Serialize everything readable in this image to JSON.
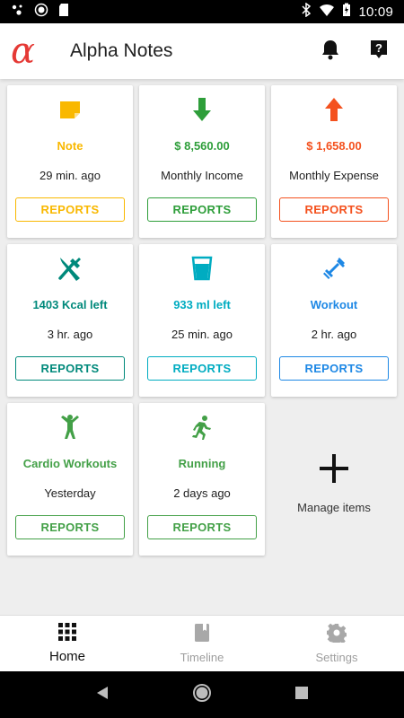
{
  "status_bar": {
    "time": "10:09"
  },
  "app": {
    "title": "Alpha Notes",
    "logo_glyph": "α",
    "logo_color": "#e53935"
  },
  "cards": [
    {
      "key": "note",
      "icon": "note-icon",
      "value": "Note",
      "sub": "29 min. ago",
      "button": "REPORTS",
      "color": "#f9b800"
    },
    {
      "key": "income",
      "icon": "arrow-down-icon",
      "value": "$ 8,560.00",
      "sub": "Monthly Income",
      "button": "REPORTS",
      "color": "#2e9e3a"
    },
    {
      "key": "expense",
      "icon": "arrow-up-icon",
      "value": "$ 1,658.00",
      "sub": "Monthly Expense",
      "button": "REPORTS",
      "color": "#f4511e"
    },
    {
      "key": "kcal",
      "icon": "fork-knife-icon",
      "value": "1403 Kcal left",
      "sub": "3 hr. ago",
      "button": "REPORTS",
      "color": "#00897b"
    },
    {
      "key": "water",
      "icon": "water-glass-icon",
      "value": "933 ml left",
      "sub": "25 min. ago",
      "button": "REPORTS",
      "color": "#00acc1"
    },
    {
      "key": "workout",
      "icon": "dumbbell-icon",
      "value": "Workout",
      "sub": "2 hr. ago",
      "button": "REPORTS",
      "color": "#1e88e5"
    },
    {
      "key": "cardio",
      "icon": "person-stretch-icon",
      "value": "Cardio Workouts",
      "sub": "Yesterday",
      "button": "REPORTS",
      "color": "#43a047"
    },
    {
      "key": "running",
      "icon": "running-icon",
      "value": "Running",
      "sub": "2 days ago",
      "button": "REPORTS",
      "color": "#43a047"
    }
  ],
  "manage": {
    "label": "Manage items",
    "icon": "plus-icon"
  },
  "bottom_nav": [
    {
      "label": "Home",
      "icon": "grid-icon",
      "active": true
    },
    {
      "label": "Timeline",
      "icon": "book-icon",
      "active": false
    },
    {
      "label": "Settings",
      "icon": "gear-icon",
      "active": false
    }
  ]
}
